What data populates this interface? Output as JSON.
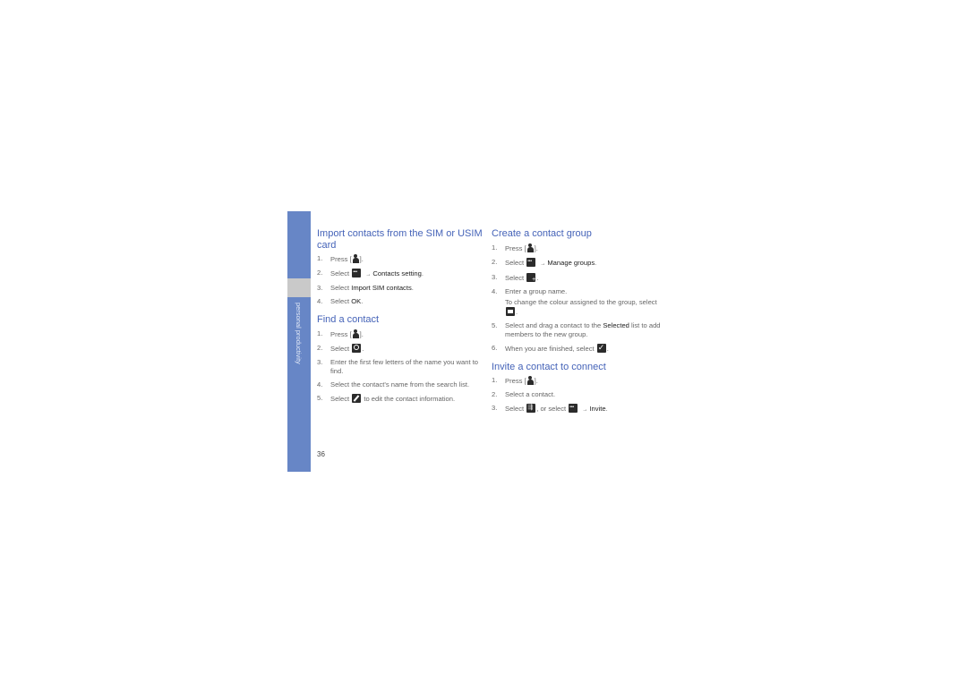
{
  "sidebar": {
    "section_label": "personal productivity"
  },
  "page_number": "36",
  "sections": {
    "import": {
      "title": "Import contacts from the SIM or USIM card",
      "steps": [
        {
          "num": "1.",
          "pre": "Press [",
          "icon": "contacts-icon",
          "post": "]."
        },
        {
          "num": "2.",
          "pre": "Select",
          "icon": "more-options-icon",
          "arrow": "→",
          "bold": "Contacts setting",
          "post": "."
        },
        {
          "num": "3.",
          "pre": "Select ",
          "bold": "Import SIM contacts",
          "post": "."
        },
        {
          "num": "4.",
          "pre": "Select ",
          "bold": "OK",
          "post": "."
        }
      ]
    },
    "find": {
      "title": "Find a contact",
      "steps": [
        {
          "num": "1.",
          "pre": "Press [",
          "icon": "contacts-icon",
          "post": "]."
        },
        {
          "num": "2.",
          "pre": "Select",
          "icon": "search-icon",
          "post": "."
        },
        {
          "num": "3.",
          "text": "Enter the first few letters of the name you want to find."
        },
        {
          "num": "4.",
          "text": "Select the contact's name from the search list."
        },
        {
          "num": "5.",
          "pre": "Select",
          "icon": "edit-icon",
          "post": "to edit the contact information."
        }
      ]
    },
    "group": {
      "title": "Create a contact group",
      "steps": [
        {
          "num": "1.",
          "pre": "Press [",
          "icon": "contacts-icon",
          "post": "]."
        },
        {
          "num": "2.",
          "pre": "Select",
          "icon": "more-options-icon",
          "arrow": "→",
          "bold": "Manage groups",
          "post": "."
        },
        {
          "num": "3.",
          "pre": "Select",
          "icon": "add-group-icon",
          "post": "."
        },
        {
          "num": "4.",
          "text": "Enter a group name.",
          "sub_pre": "To change the colour assigned to the group, select",
          "sub_icon": "colour-icon",
          "sub_post": "."
        },
        {
          "num": "5.",
          "pre": "Select and drag a contact to the ",
          "bold": "Selected",
          "post": " list to add members to the new group."
        },
        {
          "num": "6.",
          "pre": "When you are finished, select",
          "icon": "checkmark-icon",
          "post": "."
        }
      ]
    },
    "invite": {
      "title": "Invite a contact to connect",
      "steps": [
        {
          "num": "1.",
          "pre": "Press [",
          "icon": "contacts-icon",
          "post": "]."
        },
        {
          "num": "2.",
          "text": "Select a contact."
        },
        {
          "num": "3.",
          "pre": "Select",
          "icon": "invite-icon",
          "mid": ", or select",
          "icon2": "more-options-icon",
          "arrow": "→",
          "bold": "Invite",
          "post": "."
        }
      ]
    }
  }
}
